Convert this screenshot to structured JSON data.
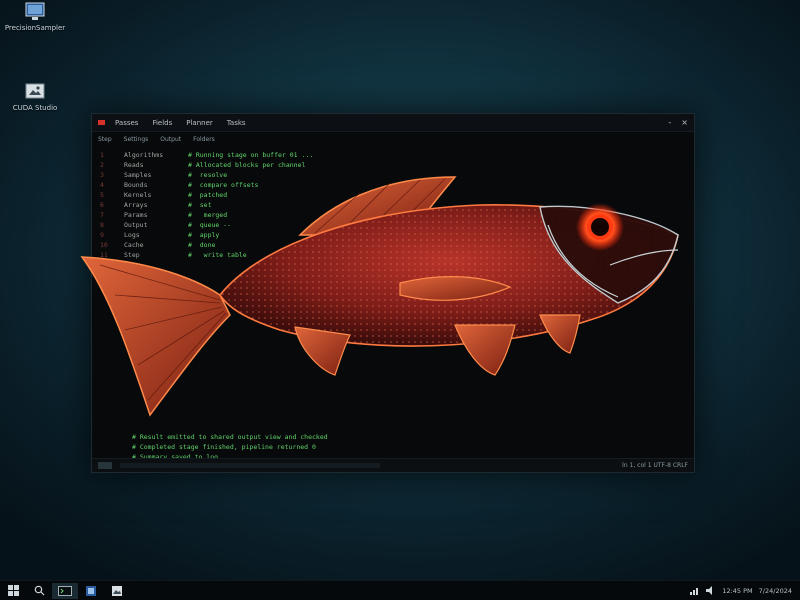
{
  "desktop": {
    "icons": [
      {
        "label": "PrecisionSampler"
      },
      {
        "label": "CUDA Studio"
      }
    ]
  },
  "window": {
    "menu": [
      "Passes",
      "Fields",
      "Planner",
      "Tasks"
    ],
    "controls": {
      "minimize": "-",
      "close": "×"
    },
    "subbar": [
      "Step",
      "Settings",
      "Output",
      "Folders"
    ],
    "lines": [
      {
        "n": "1",
        "c1": "Algorithms",
        "c2": "# Running stage on buffer 01 ..."
      },
      {
        "n": "2",
        "c1": "Reads",
        "c2": "# Allocated blocks per channel"
      },
      {
        "n": "3",
        "c1": "Samples",
        "c2": "#  resolve"
      },
      {
        "n": "4",
        "c1": "Bounds",
        "c2": "#  compare offsets"
      },
      {
        "n": "5",
        "c1": "Kernels",
        "c2": "#  patched"
      },
      {
        "n": "6",
        "c1": "Arrays",
        "c2": "#  set"
      },
      {
        "n": "7",
        "c1": "Params",
        "c2": "#   merged"
      },
      {
        "n": "8",
        "c1": "Output",
        "c2": "#  queue --"
      },
      {
        "n": "9",
        "c1": "Logs",
        "c2": "#  apply"
      },
      {
        "n": "10",
        "c1": "Cache",
        "c2": "#  done"
      },
      {
        "n": "11",
        "c1": "Step",
        "c2": "#   write table"
      }
    ],
    "lower_lines": [
      "# Result emitted to shared output view and checked",
      "# Completed stage finished, pipeline returned 0",
      "# Summary saved to log"
    ],
    "status_right": "ln 1, col 1  UTF-8  CRLF"
  },
  "taskbar": {
    "tray_time": "12:45 PM",
    "tray_date": "7/24/2024"
  }
}
